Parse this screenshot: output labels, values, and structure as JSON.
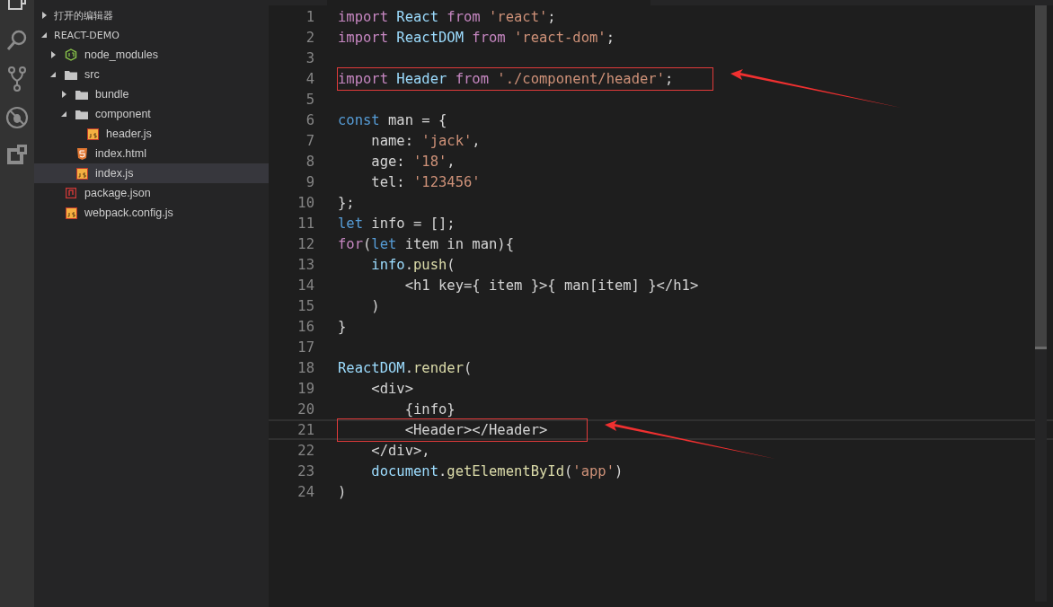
{
  "explorer": {
    "sections": [
      {
        "label": "打开的编辑器",
        "expanded": false
      },
      {
        "label": "REACT-DEMO",
        "expanded": true,
        "children": [
          {
            "label": "node_modules",
            "kind": "node",
            "expanded": false,
            "selected": false
          },
          {
            "label": "src",
            "kind": "folder",
            "expanded": true,
            "selected": false,
            "children": [
              {
                "label": "bundle",
                "kind": "folder",
                "expanded": false,
                "selected": false
              },
              {
                "label": "component",
                "kind": "folder",
                "expanded": true,
                "selected": false,
                "children": [
                  {
                    "label": "header.js",
                    "kind": "js",
                    "selected": false
                  }
                ]
              },
              {
                "label": "index.html",
                "kind": "html",
                "selected": false
              },
              {
                "label": "index.js",
                "kind": "js",
                "selected": true
              }
            ]
          },
          {
            "label": "package.json",
            "kind": "json",
            "selected": false
          },
          {
            "label": "webpack.config.js",
            "kind": "js",
            "selected": false
          }
        ]
      }
    ]
  },
  "editor": {
    "lines": [
      {
        "number": "1",
        "current": false,
        "annotated": false,
        "tokens": [
          {
            "t": "import",
            "kind": "keyword"
          },
          {
            "t": " React",
            "kind": "variable"
          },
          {
            "t": " from",
            "kind": "keyword"
          },
          {
            "t": " 'react'",
            "kind": "string"
          },
          {
            "t": ";",
            "kind": "plain"
          }
        ]
      },
      {
        "number": "2",
        "current": false,
        "annotated": false,
        "tokens": [
          {
            "t": "import",
            "kind": "keyword"
          },
          {
            "t": " ReactDOM",
            "kind": "variable"
          },
          {
            "t": " from",
            "kind": "keyword"
          },
          {
            "t": " 'react-dom'",
            "kind": "string"
          },
          {
            "t": ";",
            "kind": "plain"
          }
        ]
      },
      {
        "number": "3",
        "current": false,
        "annotated": false
      },
      {
        "number": "4",
        "current": false,
        "annotated": true,
        "tokens": [
          {
            "t": "import",
            "kind": "keyword"
          },
          {
            "t": " Header",
            "kind": "variable"
          },
          {
            "t": " from",
            "kind": "keyword"
          },
          {
            "t": " './component/header'",
            "kind": "string"
          },
          {
            "t": ";",
            "kind": "plain"
          }
        ]
      },
      {
        "number": "5",
        "current": false,
        "annotated": false
      },
      {
        "number": "6",
        "current": false,
        "annotated": false,
        "tokens": [
          {
            "t": "const",
            "kind": "declaration"
          },
          {
            "t": " man = {",
            "kind": "plain"
          }
        ]
      },
      {
        "number": "7",
        "current": false,
        "annotated": false,
        "tokens": [
          {
            "t": "    name:",
            "kind": "plain"
          },
          {
            "t": " 'jack'",
            "kind": "string"
          },
          {
            "t": ",",
            "kind": "plain"
          }
        ]
      },
      {
        "number": "8",
        "current": false,
        "annotated": false,
        "tokens": [
          {
            "t": "    age:",
            "kind": "plain"
          },
          {
            "t": " '18'",
            "kind": "string"
          },
          {
            "t": ",",
            "kind": "plain"
          }
        ]
      },
      {
        "number": "9",
        "current": false,
        "annotated": false,
        "tokens": [
          {
            "t": "    tel:",
            "kind": "plain"
          },
          {
            "t": " '123456'",
            "kind": "string"
          }
        ]
      },
      {
        "number": "10",
        "current": false,
        "annotated": false,
        "tokens": [
          {
            "t": "};",
            "kind": "plain"
          }
        ]
      },
      {
        "number": "11",
        "current": false,
        "annotated": false,
        "tokens": [
          {
            "t": "let",
            "kind": "declaration"
          },
          {
            "t": " info = [];",
            "kind": "plain"
          }
        ]
      },
      {
        "number": "12",
        "current": false,
        "annotated": false,
        "tokens": [
          {
            "t": "for",
            "kind": "keyword"
          },
          {
            "t": "(",
            "kind": "plain"
          },
          {
            "t": "let",
            "kind": "declaration"
          },
          {
            "t": " item in man){",
            "kind": "plain"
          }
        ]
      },
      {
        "number": "13",
        "current": false,
        "annotated": false,
        "tokens": [
          {
            "t": "    info",
            "kind": "variable"
          },
          {
            "t": ".",
            "kind": "plain"
          },
          {
            "t": "push",
            "kind": "function"
          },
          {
            "t": "(",
            "kind": "plain"
          }
        ]
      },
      {
        "number": "14",
        "current": false,
        "annotated": false,
        "tokens": [
          {
            "t": "        <h1 key={ item }>{ man[item] }</h1>",
            "kind": "plain"
          }
        ]
      },
      {
        "number": "15",
        "current": false,
        "annotated": false,
        "tokens": [
          {
            "t": "    )",
            "kind": "plain"
          }
        ]
      },
      {
        "number": "16",
        "current": false,
        "annotated": false,
        "tokens": [
          {
            "t": "}",
            "kind": "plain"
          }
        ]
      },
      {
        "number": "17",
        "current": false,
        "annotated": false
      },
      {
        "number": "18",
        "current": false,
        "annotated": false,
        "tokens": [
          {
            "t": "ReactDOM",
            "kind": "variable"
          },
          {
            "t": ".",
            "kind": "plain"
          },
          {
            "t": "render",
            "kind": "function"
          },
          {
            "t": "(",
            "kind": "plain"
          }
        ]
      },
      {
        "number": "19",
        "current": false,
        "annotated": false,
        "tokens": [
          {
            "t": "    <div>",
            "kind": "plain"
          }
        ]
      },
      {
        "number": "20",
        "current": false,
        "annotated": false,
        "tokens": [
          {
            "t": "        {info}",
            "kind": "plain"
          }
        ]
      },
      {
        "number": "21",
        "current": true,
        "annotated": true,
        "tokens": [
          {
            "t": "        <Header></Header>",
            "kind": "plain"
          }
        ]
      },
      {
        "number": "22",
        "current": false,
        "annotated": false,
        "tokens": [
          {
            "t": "    </div>,",
            "kind": "plain"
          }
        ]
      },
      {
        "number": "23",
        "current": false,
        "annotated": false,
        "tokens": [
          {
            "t": "    document",
            "kind": "variable"
          },
          {
            "t": ".",
            "kind": "plain"
          },
          {
            "t": "getElementById",
            "kind": "function"
          },
          {
            "t": "(",
            "kind": "plain"
          },
          {
            "t": "'app'",
            "kind": "string"
          },
          {
            "t": ")",
            "kind": "plain"
          }
        ]
      },
      {
        "number": "24",
        "current": false,
        "annotated": false,
        "tokens": [
          {
            "t": ")",
            "kind": "plain"
          }
        ]
      }
    ]
  }
}
